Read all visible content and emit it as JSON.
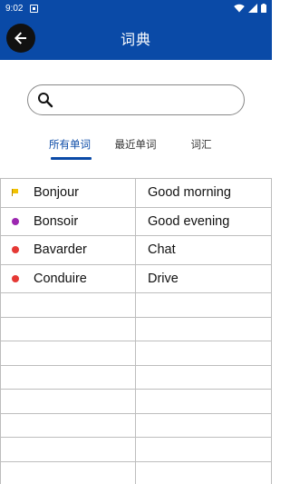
{
  "status_bar": {
    "time": "9:02",
    "icons": [
      "notification-icon",
      "wifi-icon",
      "signal-icon",
      "battery-icon"
    ]
  },
  "app_bar": {
    "title": "词典",
    "back_icon": "arrow-left-icon",
    "color": "#0a4aa7"
  },
  "search": {
    "value": "",
    "icon": "search-icon"
  },
  "tabs": [
    {
      "label": "所有单词",
      "active": true
    },
    {
      "label": "最近单词",
      "active": false
    },
    {
      "label": "词汇",
      "active": false
    }
  ],
  "words": [
    {
      "french": "Bonjour",
      "english": "Good morning",
      "marker": "flag",
      "color": "#f2c200"
    },
    {
      "french": "Bonsoir",
      "english": "Good evening",
      "marker": "dot",
      "color": "#9c27b0"
    },
    {
      "french": "Bavarder",
      "english": "Chat",
      "marker": "dot",
      "color": "#e53935"
    },
    {
      "french": "Conduire",
      "english": "Drive",
      "marker": "dot",
      "color": "#e53935"
    }
  ],
  "empty_rows": 8
}
